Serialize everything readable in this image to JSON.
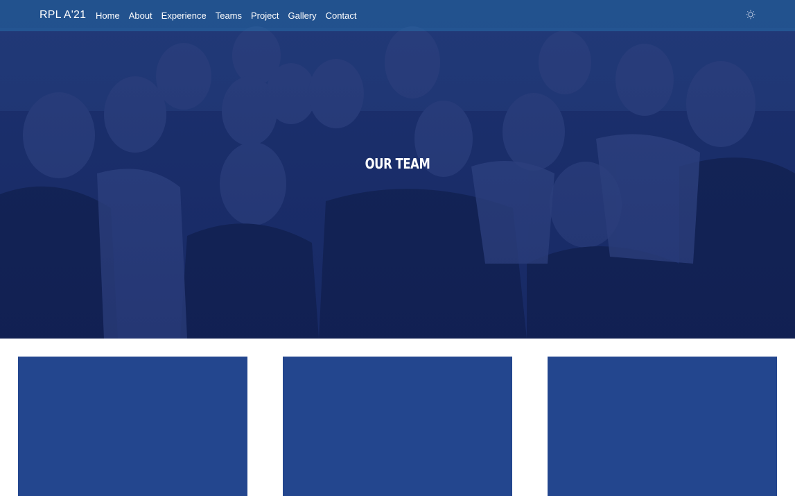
{
  "brand": "RPL A'21",
  "nav": {
    "items": [
      "Home",
      "About",
      "Experience",
      "Teams",
      "Project",
      "Gallery",
      "Contact"
    ]
  },
  "hero": {
    "title": "OUR TEAM",
    "background_icon": "group-photo"
  },
  "colors": {
    "navbar": "#2e6fa8",
    "overlay": "#1e3c8c",
    "card": "#23468e",
    "text": "#ffffff"
  },
  "cards": [
    {
      "id": "card-1"
    },
    {
      "id": "card-2"
    },
    {
      "id": "card-3"
    }
  ]
}
